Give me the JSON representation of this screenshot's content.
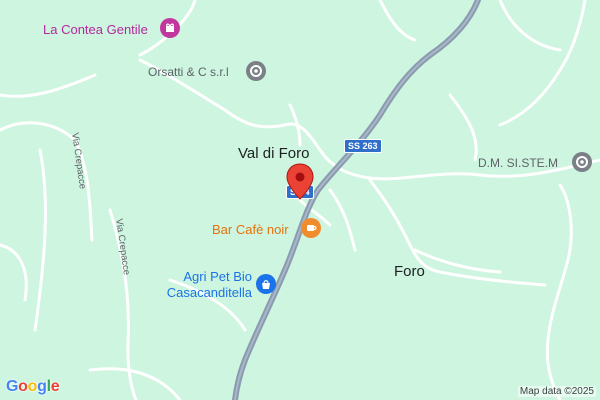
{
  "map": {
    "colors": {
      "land": "#cdf5df",
      "road": "#ffffff",
      "highway": "#8a9bb0",
      "pin": "#ea4335"
    },
    "places": {
      "val_di_foro": "Val di Foro",
      "foro": "Foro"
    },
    "pois": {
      "la_contea": "La Contea Gentile",
      "orsatti": "Orsatti & C s.r.l",
      "dm_siste": "D.M. SI.STE.M",
      "bar_cafe": "Bar Cafè noir",
      "agri_line1": "Agri Pet Bio",
      "agri_line2": "Casacanditella"
    },
    "streets": {
      "via_crepacce_1": "Via Crepacce",
      "via_crepacce_2": "Via Crepacce"
    },
    "shields": {
      "ss263": "SS 263",
      "ss_pin": "SS 4"
    },
    "attribution": "Map data ©2025",
    "logo": {
      "letters": [
        "G",
        "o",
        "o",
        "g",
        "l",
        "e"
      ],
      "colors": [
        "#4285f4",
        "#ea4335",
        "#fbbc05",
        "#4285f4",
        "#34a853",
        "#ea4335"
      ]
    },
    "icons": {
      "la_contea": "gift-shop-icon",
      "orsatti": "business-pin-icon",
      "dm_siste": "business-pin-icon",
      "bar_cafe": "coffee-cup-icon",
      "agri": "shopping-bag-icon",
      "pin": "location-pin-icon"
    }
  }
}
